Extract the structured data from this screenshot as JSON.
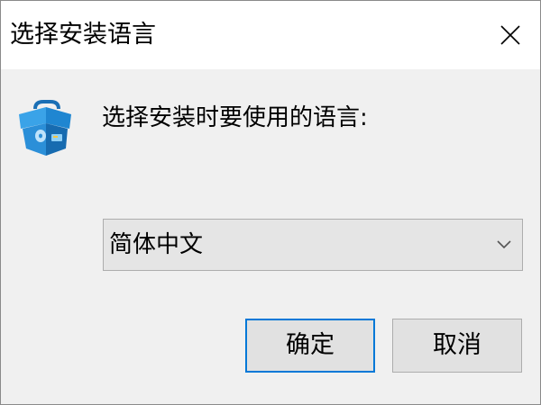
{
  "window": {
    "title": "选择安装语言"
  },
  "dialog": {
    "prompt": "选择安装时要使用的语言:",
    "language_select": {
      "selected": "简体中文"
    },
    "buttons": {
      "ok_label": "确定",
      "cancel_label": "取消"
    }
  },
  "icons": {
    "close": "close-icon",
    "app": "installer-box-icon",
    "chevron": "chevron-down-icon"
  },
  "colors": {
    "accent": "#0078d7",
    "dialog_bg": "#f0f0f0",
    "titlebar_bg": "#ffffff"
  }
}
